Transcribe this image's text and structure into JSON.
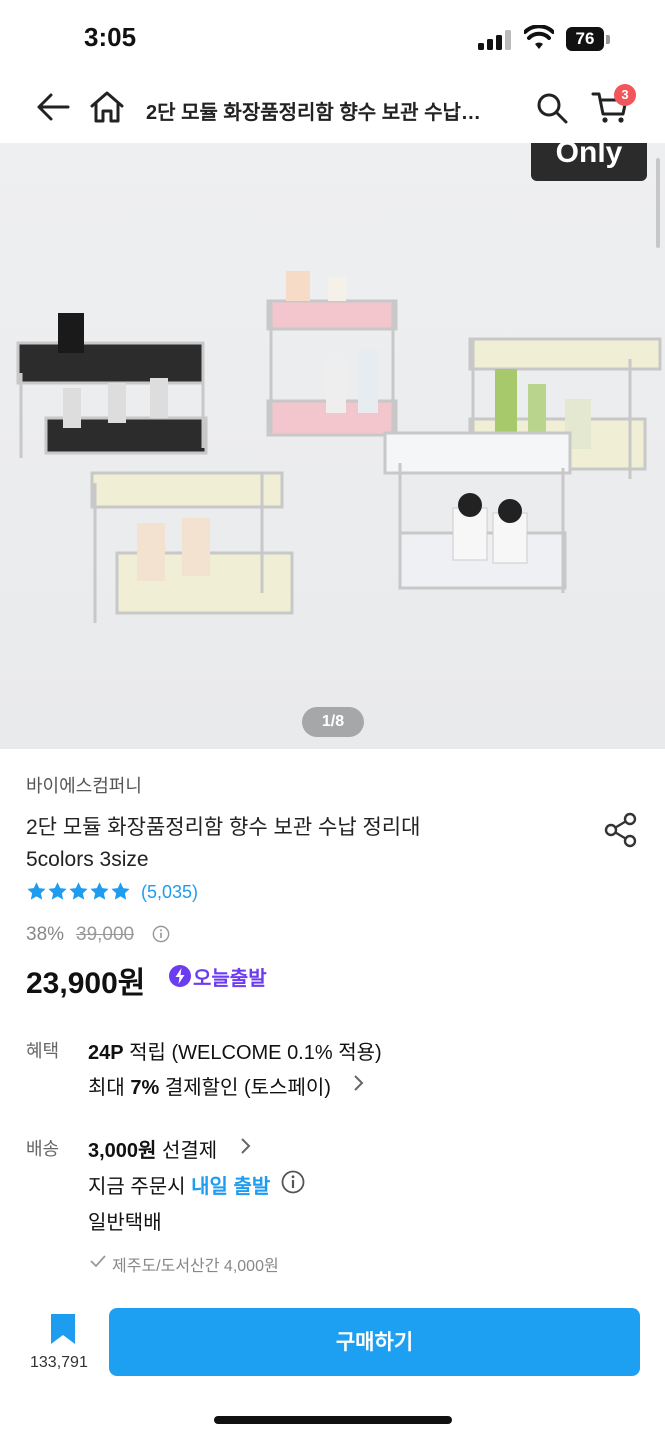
{
  "status": {
    "time": "3:05",
    "battery": "76"
  },
  "header": {
    "title": "2단 모듈 화장품정리함 향수 보관 수납…",
    "cart_count": "3"
  },
  "gallery": {
    "badge_text": "Only",
    "indicator": "1/8"
  },
  "product": {
    "brand": "바이에스컴퍼니",
    "title_line1": "2단 모듈 화장품정리함 향수 보관 수납 정리대",
    "title_line2": "5colors 3size",
    "review_count": "(5,035)",
    "discount": "38%",
    "original_price": "39,000",
    "price": "23,900원",
    "delivery_badge": "오늘출발",
    "rating": 5
  },
  "benefit": {
    "label": "혜택",
    "points_bold": "24P",
    "points_rest": " 적립 (WELCOME 0.1% 적용)",
    "discount_pre": "최대 ",
    "discount_bold": "7%",
    "discount_rest": " 결제할인 (토스페이)"
  },
  "shipping": {
    "label": "배송",
    "fee_bold": "3,000원",
    "fee_rest": " 선결제",
    "now_pre": "지금 주문시 ",
    "now_blue": "내일 출발",
    "type": "일반택배",
    "jeju": "제주도/도서산간 4,000원"
  },
  "footer": {
    "bookmark_count": "133,791",
    "buy_label": "구매하기"
  },
  "colors": {
    "accent": "#1ea0f2",
    "badge": "#f2555a",
    "star": "#1e9cf0",
    "today": "#6c3cf0"
  }
}
